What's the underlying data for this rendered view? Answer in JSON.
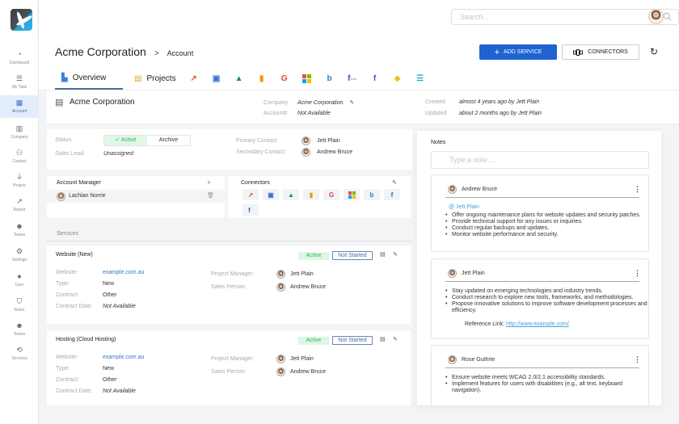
{
  "sidebar": {
    "items": [
      {
        "label": "Dashboard",
        "icon": "dashboard-icon"
      },
      {
        "label": "My Task",
        "icon": "task-icon"
      },
      {
        "label": "Account",
        "icon": "account-icon",
        "active": true
      },
      {
        "label": "Company",
        "icon": "company-icon"
      },
      {
        "label": "Contact",
        "icon": "contact-icon"
      },
      {
        "label": "Project",
        "icon": "project-icon"
      },
      {
        "label": "Report",
        "icon": "report-icon"
      },
      {
        "label": "Teams",
        "icon": "teams-icon"
      },
      {
        "label": "Settings",
        "icon": "settings-icon"
      },
      {
        "label": "User",
        "icon": "user-icon"
      },
      {
        "label": "Roles",
        "icon": "roles-icon"
      },
      {
        "label": "Teams",
        "icon": "teams-icon"
      },
      {
        "label": "Services",
        "icon": "services-icon"
      }
    ]
  },
  "topbar": {
    "search_placeholder": "Search..."
  },
  "header": {
    "title": "Acme Corporation",
    "separator": ">",
    "subtitle": "Account",
    "add_service_label": "ADD SERVICE",
    "connectors_label": "CONNECTORS",
    "tabs": [
      {
        "label": "Overview",
        "active": true
      },
      {
        "label": "Projects"
      }
    ],
    "connector_tabs": [
      "analytics-trend",
      "google-business",
      "google-ads",
      "google-analytics",
      "google-search-console",
      "microsoft",
      "bing",
      "facebook-ads",
      "facebook",
      "google-my-business",
      "list-app"
    ]
  },
  "account": {
    "name": "Acme Corporation",
    "company_label": "Company",
    "company_value": "Acme Corporation",
    "account_label": "Account#",
    "account_value": "Not Available",
    "created_label": "Created",
    "created_value": "almost 4 years ago by Jett Plain",
    "updated_label": "Updated",
    "updated_value": "about 2 months ago by Jett Plain"
  },
  "status": {
    "status_label": "Status:",
    "active_label": "Active",
    "archive_label": "Archive",
    "sales_lead_label": "Sales Lead:",
    "sales_lead_value": "Unassigned",
    "primary_contact_label": "Primary Contact:",
    "primary_contact_value": "Jett Plain",
    "secondary_contact_label": "Secondary Contact:",
    "secondary_contact_value": "Andrew Bruce"
  },
  "account_manager": {
    "title": "Account Manager",
    "add": "+",
    "name": "Lachlan Norrie"
  },
  "connectors": {
    "title": "Connectors",
    "items": [
      {
        "name": "analytics-trend",
        "glyph": "↗",
        "color": "#e05a2b"
      },
      {
        "name": "google-business",
        "glyph": "▣",
        "color": "#3b6fd8"
      },
      {
        "name": "google-ads",
        "glyph": "▲",
        "color": "#1f8f3f"
      },
      {
        "name": "google-analytics",
        "glyph": "▮",
        "color": "#f29900"
      },
      {
        "name": "google-search-console",
        "glyph": "G",
        "color": "#e0413a"
      },
      {
        "name": "microsoft",
        "glyph": "■",
        "color": "#e84d2b"
      },
      {
        "name": "bing",
        "glyph": "b",
        "color": "#2b7cd3"
      },
      {
        "name": "facebook",
        "glyph": "f",
        "color": "#2d5fb3"
      },
      {
        "name": "facebook-ads",
        "glyph": "f",
        "color": "#2d5fb3"
      }
    ]
  },
  "services": {
    "title": "Services",
    "items": [
      {
        "title": "Website (New)",
        "active": "Active",
        "state": "Not Started",
        "website_label": "Website:",
        "website": "example.com.au",
        "type_label": "Type:",
        "type": "New",
        "contract_label": "Contract:",
        "contract": "Other",
        "contract_date_label": "Contract Date:",
        "contract_date": "Not Available",
        "pm_label": "Project Manager:",
        "pm": "Jett Plain",
        "sales_label": "Sales Person:",
        "sales": "Andrew Bruce"
      },
      {
        "title": "Hosting (Cloud Hosting)",
        "active": "Active",
        "state": "Not Started",
        "website_label": "Website:",
        "website": "example.com.au",
        "type_label": "Type:",
        "type": "New",
        "contract_label": "Contract:",
        "contract": "Other",
        "contract_date_label": "Contract Date:",
        "contract_date": "Not Available",
        "pm_label": "Project Manager:",
        "pm": "Jett Plain",
        "sales_label": "Sales Person:",
        "sales": "Andrew Bruce"
      }
    ]
  },
  "notes": {
    "title": "Notes",
    "placeholder": "Type a note....",
    "items": [
      {
        "author": "Andrew Bruce",
        "mention": "@ Jett Plain",
        "bullets": [
          "Offer ongoing maintenance plans for website updates and security patches.",
          "Provide technical support for any issues or inquiries.",
          "Conduct regular backups and updates.",
          "Monitor website performance and security."
        ]
      },
      {
        "author": "Jett Plain",
        "bullets": [
          "Stay updated on emerging technologies and industry trends.",
          "Conduct research to explore new tools, frameworks, and methodologies.",
          "Propose innovative solutions to improve software development processes and efficiency."
        ],
        "reference_label": "Reference Link:",
        "reference_link": "http://www.example.com/"
      },
      {
        "author": "Rose Guthrie",
        "bullets": [
          "Ensure website meets WCAG 2.0/2.1 accessibility standards.",
          "Implement features for users with disabilities (e.g., alt text, keyboard navigation)."
        ]
      }
    ]
  },
  "colors": {
    "primary": "#1e63d0",
    "active_green": "#39b35b",
    "active_bg": "#dff7e5",
    "link": "#3a78c2",
    "mention": "#3aa6d9"
  }
}
